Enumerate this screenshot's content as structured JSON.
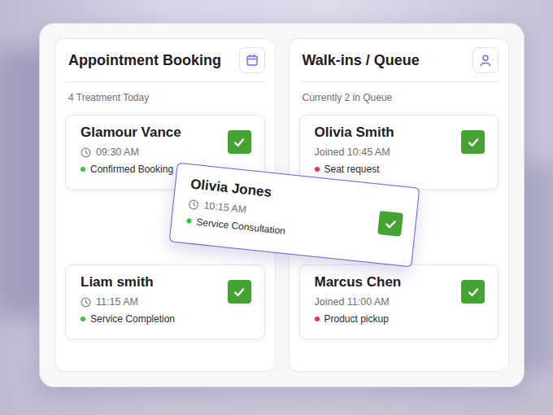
{
  "columns": [
    {
      "title": "Appointment Booking",
      "kind": "appointments",
      "subtitle": "4 Treatment Today",
      "items": [
        {
          "name": "Glamour Vance",
          "kind": "booking",
          "time": "09:30 AM",
          "status": "Confirmed Booking",
          "color": "#3cc13b",
          "checked": true
        },
        {
          "name": "Liam smith",
          "kind": "booking",
          "time": "11:15 AM",
          "status": "Service Completion",
          "color": "#3cc13b",
          "checked": true
        }
      ]
    },
    {
      "title": "Walk-ins / Queue",
      "kind": "queue",
      "subtitle": "Currently 2 in Queue",
      "items": [
        {
          "name": "Olivia Smith",
          "kind": "walk-in",
          "time": "Joined 10:45 AM",
          "status": "Seat request",
          "color": "#e8336d",
          "checked": true
        },
        {
          "name": "Marcus Chen",
          "kind": "walk-in",
          "time": "Joined 11:00 AM",
          "status": "Product pickup",
          "color": "#e8336d",
          "checked": true
        }
      ]
    }
  ],
  "dragged_card": {
    "name": "Olivia Jones",
    "kind": "booking",
    "time": "10:15 AM",
    "status": "Service Consultation",
    "color": "#3cc13b",
    "checked": true
  }
}
